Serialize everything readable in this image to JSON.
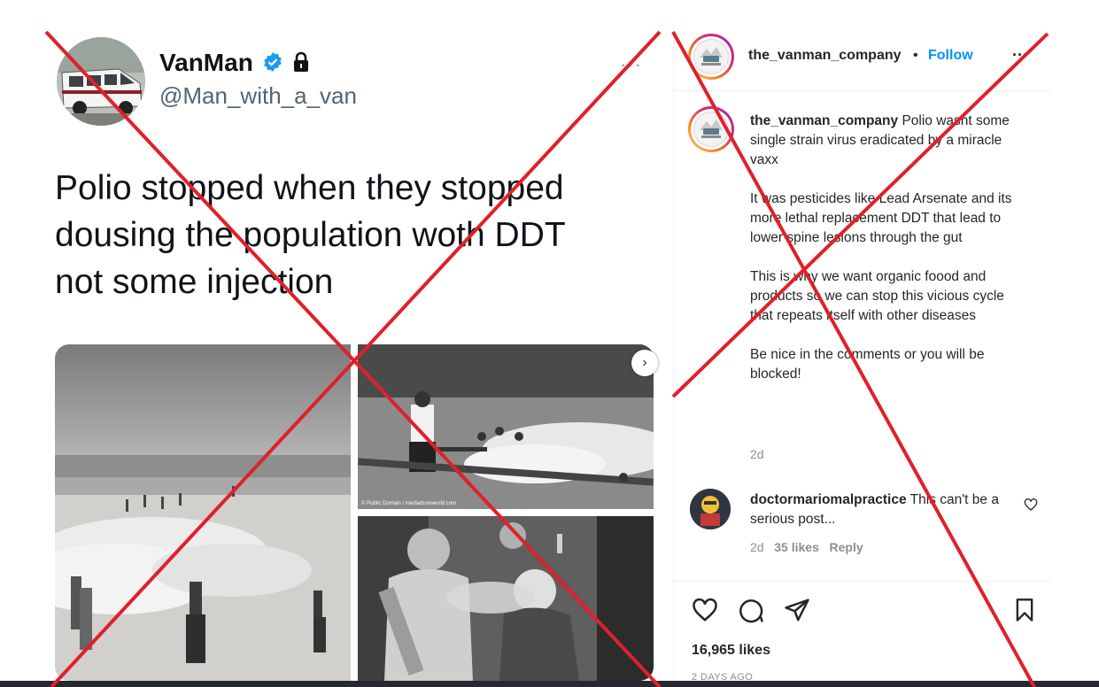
{
  "tweet": {
    "name": "VanMan",
    "handle": "@Man_with_a_van",
    "more": "···",
    "text": "Polio stopped when they stopped dousing the population woth DDT not some injection",
    "image_credit": "© Public Domain / mediadrumworld.com",
    "icons": [
      "verified-badge",
      "lock-icon",
      "more-icon",
      "next-chevron-icon"
    ]
  },
  "instagram": {
    "username": "the_vanman_company",
    "separator": "•",
    "follow": "Follow",
    "more": "···",
    "caption": {
      "username": "the_vanman_company",
      "line1": "Polio wasnt some single strain virus eradicated by a miracle vaxx",
      "para2": "It was pesticides like Lead Arsenate and its more lethal replacement DDT that lead to lower spine lesions through the gut",
      "para3": "This is why we want organic foood and products so we can stop this vicious cycle that repeats itself with other diseases",
      "para4": "Be nice in the comments or you will be blocked!",
      "time": "2d"
    },
    "comment": {
      "username": "doctormariomalpractice",
      "text": "This can't be a serious post...",
      "time": "2d",
      "likes": "35 likes",
      "reply": "Reply"
    },
    "likes": "16,965 likes",
    "posted": "2 DAYS AGO",
    "icons": [
      "heart-icon",
      "comment-icon",
      "share-icon",
      "bookmark-icon"
    ]
  },
  "colors": {
    "cross": "#e0202a",
    "follow": "#0095f6",
    "verified": "#1d9bf0"
  }
}
